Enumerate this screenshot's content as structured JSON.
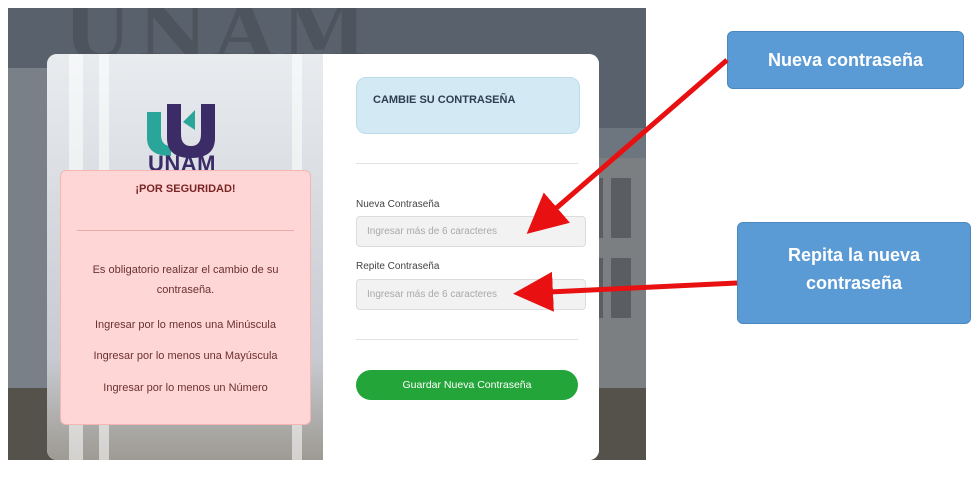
{
  "background": {
    "building_text": "UNAM"
  },
  "logo": {
    "text": "UNAM",
    "color_primary": "#3b2b66",
    "color_accent": "#2aa59a"
  },
  "security_panel": {
    "title": "¡POR SEGURIDAD!",
    "items": [
      "Es obligatorio realizar el cambio de su contraseña.",
      "Ingresar por lo menos una Minúscula",
      "Ingresar por lo menos una Mayúscula",
      "Ingresar por lo menos un Número"
    ]
  },
  "form": {
    "header": "CAMBIE SU CONTRASEÑA",
    "new_password": {
      "label": "Nueva Contraseña",
      "placeholder": "Ingresar más de 6 caracteres",
      "value": ""
    },
    "repeat_password": {
      "label": "Repite Contraseña",
      "placeholder": "Ingresar más de 6 caracteres",
      "value": ""
    },
    "save_label": "Guardar Nueva Contraseña"
  },
  "callouts": {
    "new_password": "Nueva contraseña",
    "repeat_password": "Repita la nueva contraseña"
  },
  "colors": {
    "callout_bg": "#5b9bd5",
    "arrow": "#e81010",
    "save_button": "#23a539",
    "security_bg": "#ffd6d6",
    "header_bg": "#d3e9f3"
  }
}
